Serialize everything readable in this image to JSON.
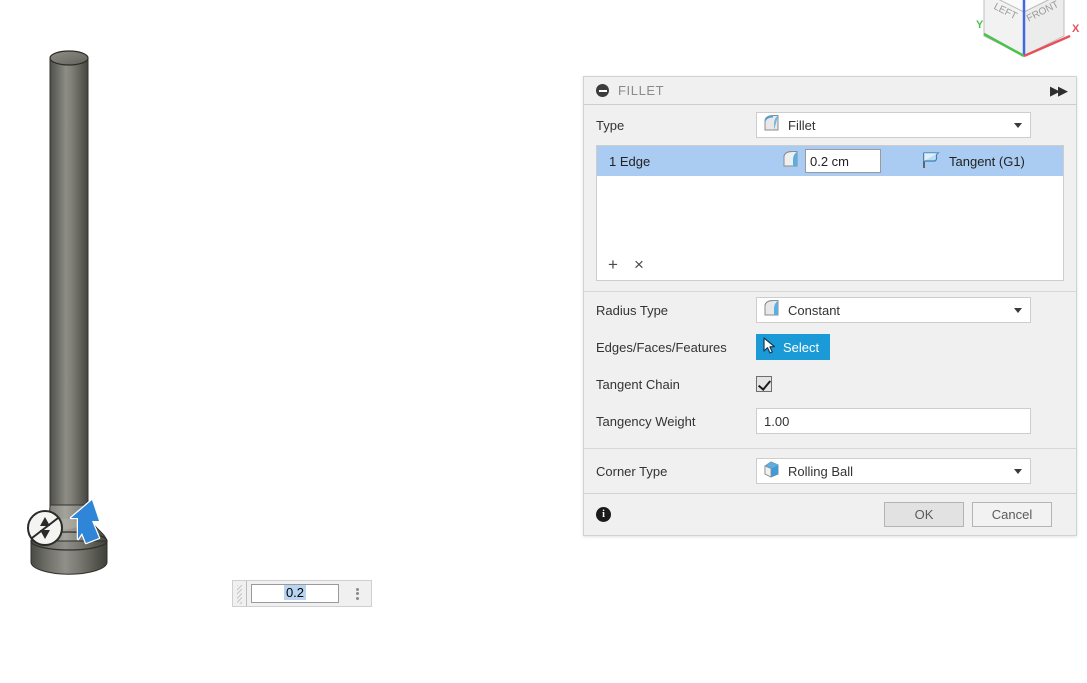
{
  "viewcube": {
    "face_left": "LEFT",
    "face_front": "FRONT",
    "axis_x": "X",
    "axis_y": "Y",
    "colors": {
      "x": "#e8505b",
      "y": "#4cc24c",
      "z": "#4169e1"
    }
  },
  "canvas": {
    "value_field": {
      "value": "0.2",
      "grip_icon": "drag-grip-icon",
      "menu_icon": "more-options-icon"
    },
    "manipulator": {
      "handle_icon": "arrow-updown-handle-icon",
      "cursor_icon": "mouse-pointer-icon"
    },
    "model_name": "cylindrical-post-with-filleted-base"
  },
  "panel": {
    "title": "FILLET",
    "collapse_icon": "collapse-minus-icon",
    "expand_icon": "fast-forward-icon",
    "type_row": {
      "label": "Type",
      "value": "Fillet",
      "icon": "fillet-type-icon",
      "caret_icon": "chevron-down-icon"
    },
    "edge_list": {
      "rows": [
        {
          "name": "1 Edge",
          "icon": "fillet-edge-icon",
          "radius": "0.2 cm",
          "continuity": "Tangent (G1)",
          "continuity_icon": "tangent-flag-icon"
        }
      ],
      "add_label": "+",
      "remove_label": "×"
    },
    "radius_type_row": {
      "label": "Radius Type",
      "value": "Constant",
      "icon": "constant-radius-icon",
      "caret_icon": "chevron-down-icon"
    },
    "selection_row": {
      "label": "Edges/Faces/Features",
      "button_label": "Select",
      "button_icon": "cursor-select-icon",
      "button_color": "#1a9bd7"
    },
    "tangent_chain_row": {
      "label": "Tangent Chain",
      "checked": true,
      "checkbox_icon": "checkbox-checked-icon"
    },
    "tangency_weight_row": {
      "label": "Tangency Weight",
      "value": "1.00"
    },
    "corner_type_row": {
      "label": "Corner Type",
      "value": "Rolling Ball",
      "icon": "rolling-ball-icon",
      "caret_icon": "chevron-down-icon"
    },
    "footer": {
      "info_icon": "info-icon",
      "info_glyph": "i",
      "ok_label": "OK",
      "cancel_label": "Cancel"
    }
  }
}
